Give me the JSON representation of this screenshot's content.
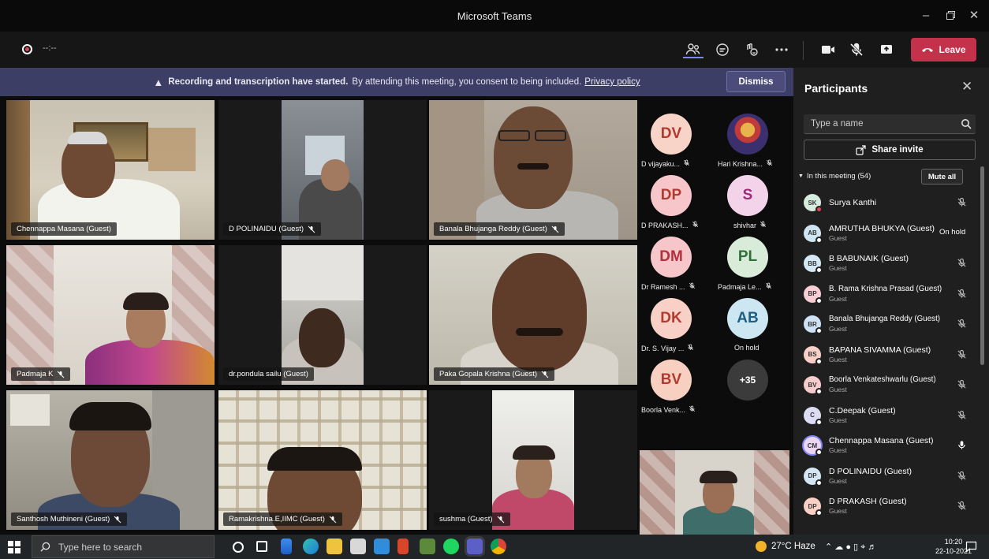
{
  "window": {
    "title": "Microsoft Teams"
  },
  "toolbar": {
    "timer": "--:--",
    "leave_label": "Leave"
  },
  "banner": {
    "bold_text": "Recording and transcription have started.",
    "text": "By attending this meeting, you consent to being included.",
    "link": "Privacy policy",
    "dismiss_label": "Dismiss"
  },
  "videos": [
    "Chennappa Masana (Guest)",
    "D POLINAIDU (Guest)",
    "Banala Bhujanga Reddy (Guest)",
    "Padmaja K",
    "dr.pondula sailu (Guest)",
    "Paka Gopala Krishna (Guest)",
    "Santhosh Muthineni (Guest)",
    "Ramakrishna.E,IIMC (Guest)",
    "sushma (Guest)"
  ],
  "avatars": [
    {
      "initials": "DV",
      "label": "D vijayaku...",
      "bg": "#f8d3c8",
      "fg": "#b23a2f"
    },
    {
      "initials": "",
      "label": "Hari Krishna...",
      "bg": "#3b2f6e",
      "fg": "#ffffff"
    },
    {
      "initials": "DP",
      "label": "D PRAKASH...",
      "bg": "#f7c6cb",
      "fg": "#b23a2f"
    },
    {
      "initials": "S",
      "label": "shivhar",
      "bg": "#f2d3ea",
      "fg": "#9c2b7a"
    },
    {
      "initials": "DM",
      "label": "Dr Ramesh ...",
      "bg": "#f6c6cb",
      "fg": "#b2303c"
    },
    {
      "initials": "PL",
      "label": "Padmaja Le...",
      "bg": "#d9ecd9",
      "fg": "#2f6f3a"
    },
    {
      "initials": "DK",
      "label": "Dr. S. Vijay ...",
      "bg": "#f8d0c6",
      "fg": "#b23a2f"
    },
    {
      "initials": "AB",
      "label": "On hold",
      "bg": "#cde7f2",
      "fg": "#1e5f82"
    },
    {
      "initials": "BV",
      "label": "Boorla Venk...",
      "bg": "#f8d0c2",
      "fg": "#b23a2f"
    },
    {
      "initials": "+35",
      "label": "",
      "bg": "#3b3b3b",
      "fg": "#ffffff"
    }
  ],
  "panel": {
    "title": "Participants",
    "search_placeholder": "Type a name",
    "share_label": "Share invite",
    "in_meeting": "In this meeting (54)",
    "mute_all": "Mute all",
    "participants": [
      {
        "initials": "SK",
        "name": "Surya Kanthi",
        "sub": "",
        "bg": "#d5ecdf",
        "status": "red",
        "right": "mic-off"
      },
      {
        "initials": "AB",
        "name": "AMRUTHA BHUKYA (Guest)",
        "sub": "Guest",
        "bg": "#cfe6f2",
        "status": "white",
        "right": "On hold"
      },
      {
        "initials": "BB",
        "name": "B BABUNAIK (Guest)",
        "sub": "Guest",
        "bg": "#d4e9f5",
        "status": "white",
        "right": "mic-off"
      },
      {
        "initials": "BP",
        "name": "B. Rama Krishna Prasad (Guest)",
        "sub": "Guest",
        "bg": "#f8cdd3",
        "status": "white",
        "right": "mic-off"
      },
      {
        "initials": "BR",
        "name": "Banala Bhujanga Reddy (Guest)",
        "sub": "Guest",
        "bg": "#cfe1f5",
        "status": "white",
        "right": "mic-off"
      },
      {
        "initials": "BS",
        "name": "BAPANA SIVAMMA (Guest)",
        "sub": "Guest",
        "bg": "#f8d0c8",
        "status": "white",
        "right": "mic-off"
      },
      {
        "initials": "BV",
        "name": "Boorla Venkateshwarlu (Guest)",
        "sub": "Guest",
        "bg": "#f6cccf",
        "status": "white",
        "right": "mic-off"
      },
      {
        "initials": "C",
        "name": "C.Deepak (Guest)",
        "sub": "Guest",
        "bg": "#dcdcf5",
        "status": "white",
        "right": "mic-off"
      },
      {
        "initials": "CM",
        "name": "Chennappa Masana (Guest)",
        "sub": "Guest",
        "bg": "#ead5f2",
        "status": "white",
        "right": "mic-on"
      },
      {
        "initials": "DP",
        "name": "D POLINAIDU (Guest)",
        "sub": "Guest",
        "bg": "#d4e6f3",
        "status": "white",
        "right": "mic-off"
      },
      {
        "initials": "DP",
        "name": "D PRAKASH (Guest)",
        "sub": "Guest",
        "bg": "#f8d0c6",
        "status": "white",
        "right": "mic-off"
      }
    ]
  },
  "taskbar": {
    "search_placeholder": "Type here to search",
    "weather": "27°C  Haze",
    "time": "10:20",
    "date": "22-10-2021"
  }
}
